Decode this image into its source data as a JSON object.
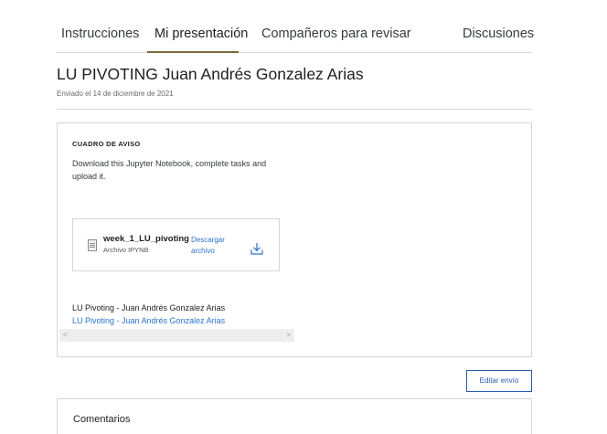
{
  "tabs": [
    {
      "label": "Instrucciones"
    },
    {
      "label": "Mi presentación"
    },
    {
      "label": "Compañeros para revisar"
    },
    {
      "label": "Discusiones"
    }
  ],
  "active_tab_index": 1,
  "submission": {
    "title": "LU PIVOTING Juan Andrés Gonzalez Arias",
    "submitted_date": "Enviado el 14 de diciembre de 2021"
  },
  "card": {
    "heading": "CUADRO DE AVISO",
    "description": "Download this Jupyter Notebook, complete tasks and upload it.",
    "attachment": {
      "file_name": "week_1_LU_pivoting",
      "file_type": "Archivo IPYNB",
      "download_label": "Descargar archivo",
      "icon": "download-icon"
    },
    "link_text": "LU Pivoting - Juan Andrés Gonzalez Arias",
    "link_anchor": "LU Pivoting - Juan Andrés Gonzalez Arias",
    "scroll_left": "<",
    "scroll_right": ">"
  },
  "edit_button": "Editar envío",
  "comments": {
    "title": "Comentarios"
  },
  "colors": {
    "link": "#2a73cc",
    "tab_underline": "#7a6a3a",
    "button_border": "#2a5db0"
  }
}
